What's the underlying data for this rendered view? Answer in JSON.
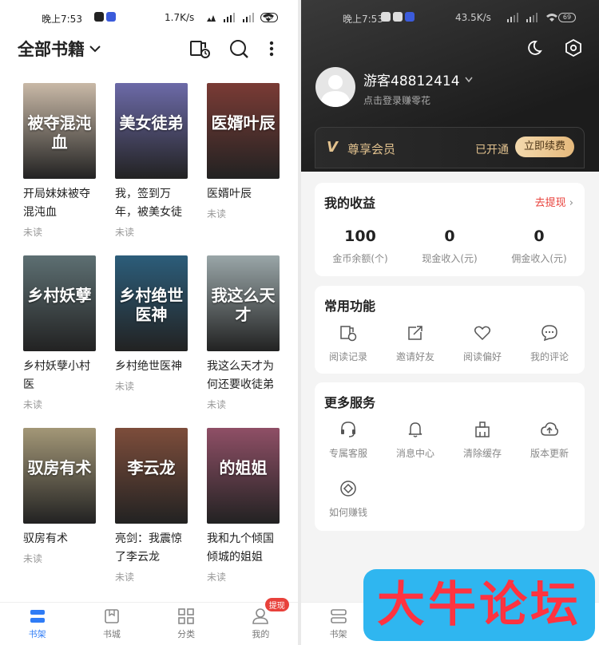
{
  "left": {
    "status": {
      "time": "晚上7:53",
      "net": "1.7K/s",
      "battery": "69"
    },
    "header": {
      "title": "全部书籍",
      "icons": [
        "read-history-icon",
        "search-icon",
        "more-icon"
      ]
    },
    "books": [
      {
        "title": "开局妹妹被夺混沌血",
        "status": "未读",
        "cover_text": "被夺混沌血",
        "color": "#c9b9a7"
      },
      {
        "title": "我，签到万年，被美女徒",
        "status": "未读",
        "cover_text": "美女徒弟",
        "color": "#6c6aa8"
      },
      {
        "title": "医婿叶辰",
        "status": "未读",
        "cover_text": "医婿叶辰",
        "color": "#7a3b35"
      },
      {
        "title": "乡村妖孽小村医",
        "status": "未读",
        "cover_text": "乡村妖孽",
        "color": "#5d6f72"
      },
      {
        "title": "乡村绝世医神",
        "status": "未读",
        "cover_text": "乡村绝世医神",
        "color": "#2c5d7a"
      },
      {
        "title": "我这么天才为何还要收徒弟",
        "status": "未读",
        "cover_text": "我这么天才",
        "color": "#9aa6a8"
      },
      {
        "title": "驭房有术",
        "status": "未读",
        "cover_text": "驭房有术",
        "color": "#a39777"
      },
      {
        "title": "亮剑：我震惊了李云龙",
        "status": "未读",
        "cover_text": "李云龙",
        "color": "#7d4d3b"
      },
      {
        "title": "我和九个倾国倾城的姐姐",
        "status": "未读",
        "cover_text": "的姐姐",
        "color": "#8f4f66"
      }
    ],
    "tabs": [
      {
        "label": "书架",
        "icon": "bookshelf-icon"
      },
      {
        "label": "书城",
        "icon": "bookstore-icon"
      },
      {
        "label": "分类",
        "icon": "category-icon"
      },
      {
        "label": "我的",
        "icon": "profile-icon"
      }
    ],
    "badge": "提现"
  },
  "right": {
    "status": {
      "time": "晚上7:53",
      "net": "43.5K/s",
      "battery": "69"
    },
    "user": {
      "name": "游客48812414",
      "subtitle": "点击登录赚零花"
    },
    "vip": {
      "title": "尊享会员",
      "state": "已开通",
      "button": "立即续费"
    },
    "earnings": {
      "title": "我的收益",
      "link": "去提现",
      "items": [
        {
          "value": "100",
          "label": "金币余额(个)"
        },
        {
          "value": "0",
          "label": "现金收入(元)"
        },
        {
          "value": "0",
          "label": "佣金收入(元)"
        }
      ]
    },
    "common": {
      "title": "常用功能",
      "items": [
        {
          "label": "阅读记录",
          "icon": "history-icon"
        },
        {
          "label": "邀请好友",
          "icon": "share-icon"
        },
        {
          "label": "阅读偏好",
          "icon": "heart-icon"
        },
        {
          "label": "我的评论",
          "icon": "comment-icon"
        }
      ]
    },
    "more": {
      "title": "更多服务",
      "items": [
        {
          "label": "专属客服",
          "icon": "headset-icon"
        },
        {
          "label": "消息中心",
          "icon": "bell-icon"
        },
        {
          "label": "清除缓存",
          "icon": "broom-icon"
        },
        {
          "label": "版本更新",
          "icon": "cloud-upload-icon"
        },
        {
          "label": "如何赚钱",
          "icon": "coin-icon"
        }
      ]
    },
    "tab_label": "书架"
  },
  "watermark": "大牛论坛"
}
